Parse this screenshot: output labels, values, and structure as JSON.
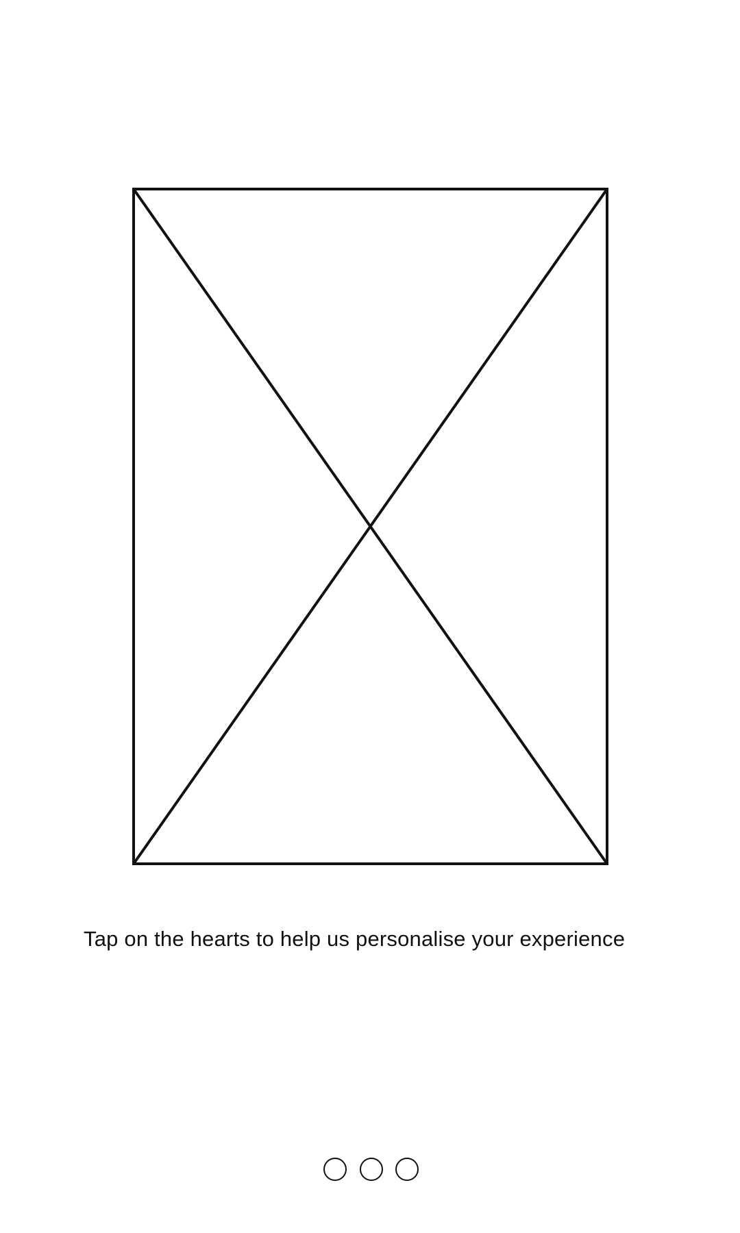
{
  "placeholder": {
    "icon": "image-placeholder-icon"
  },
  "instruction": {
    "text": "Tap on the hearts to help us personalise your experience"
  },
  "pager": {
    "pages": 3,
    "icon": "page-indicator-dot-icon"
  }
}
